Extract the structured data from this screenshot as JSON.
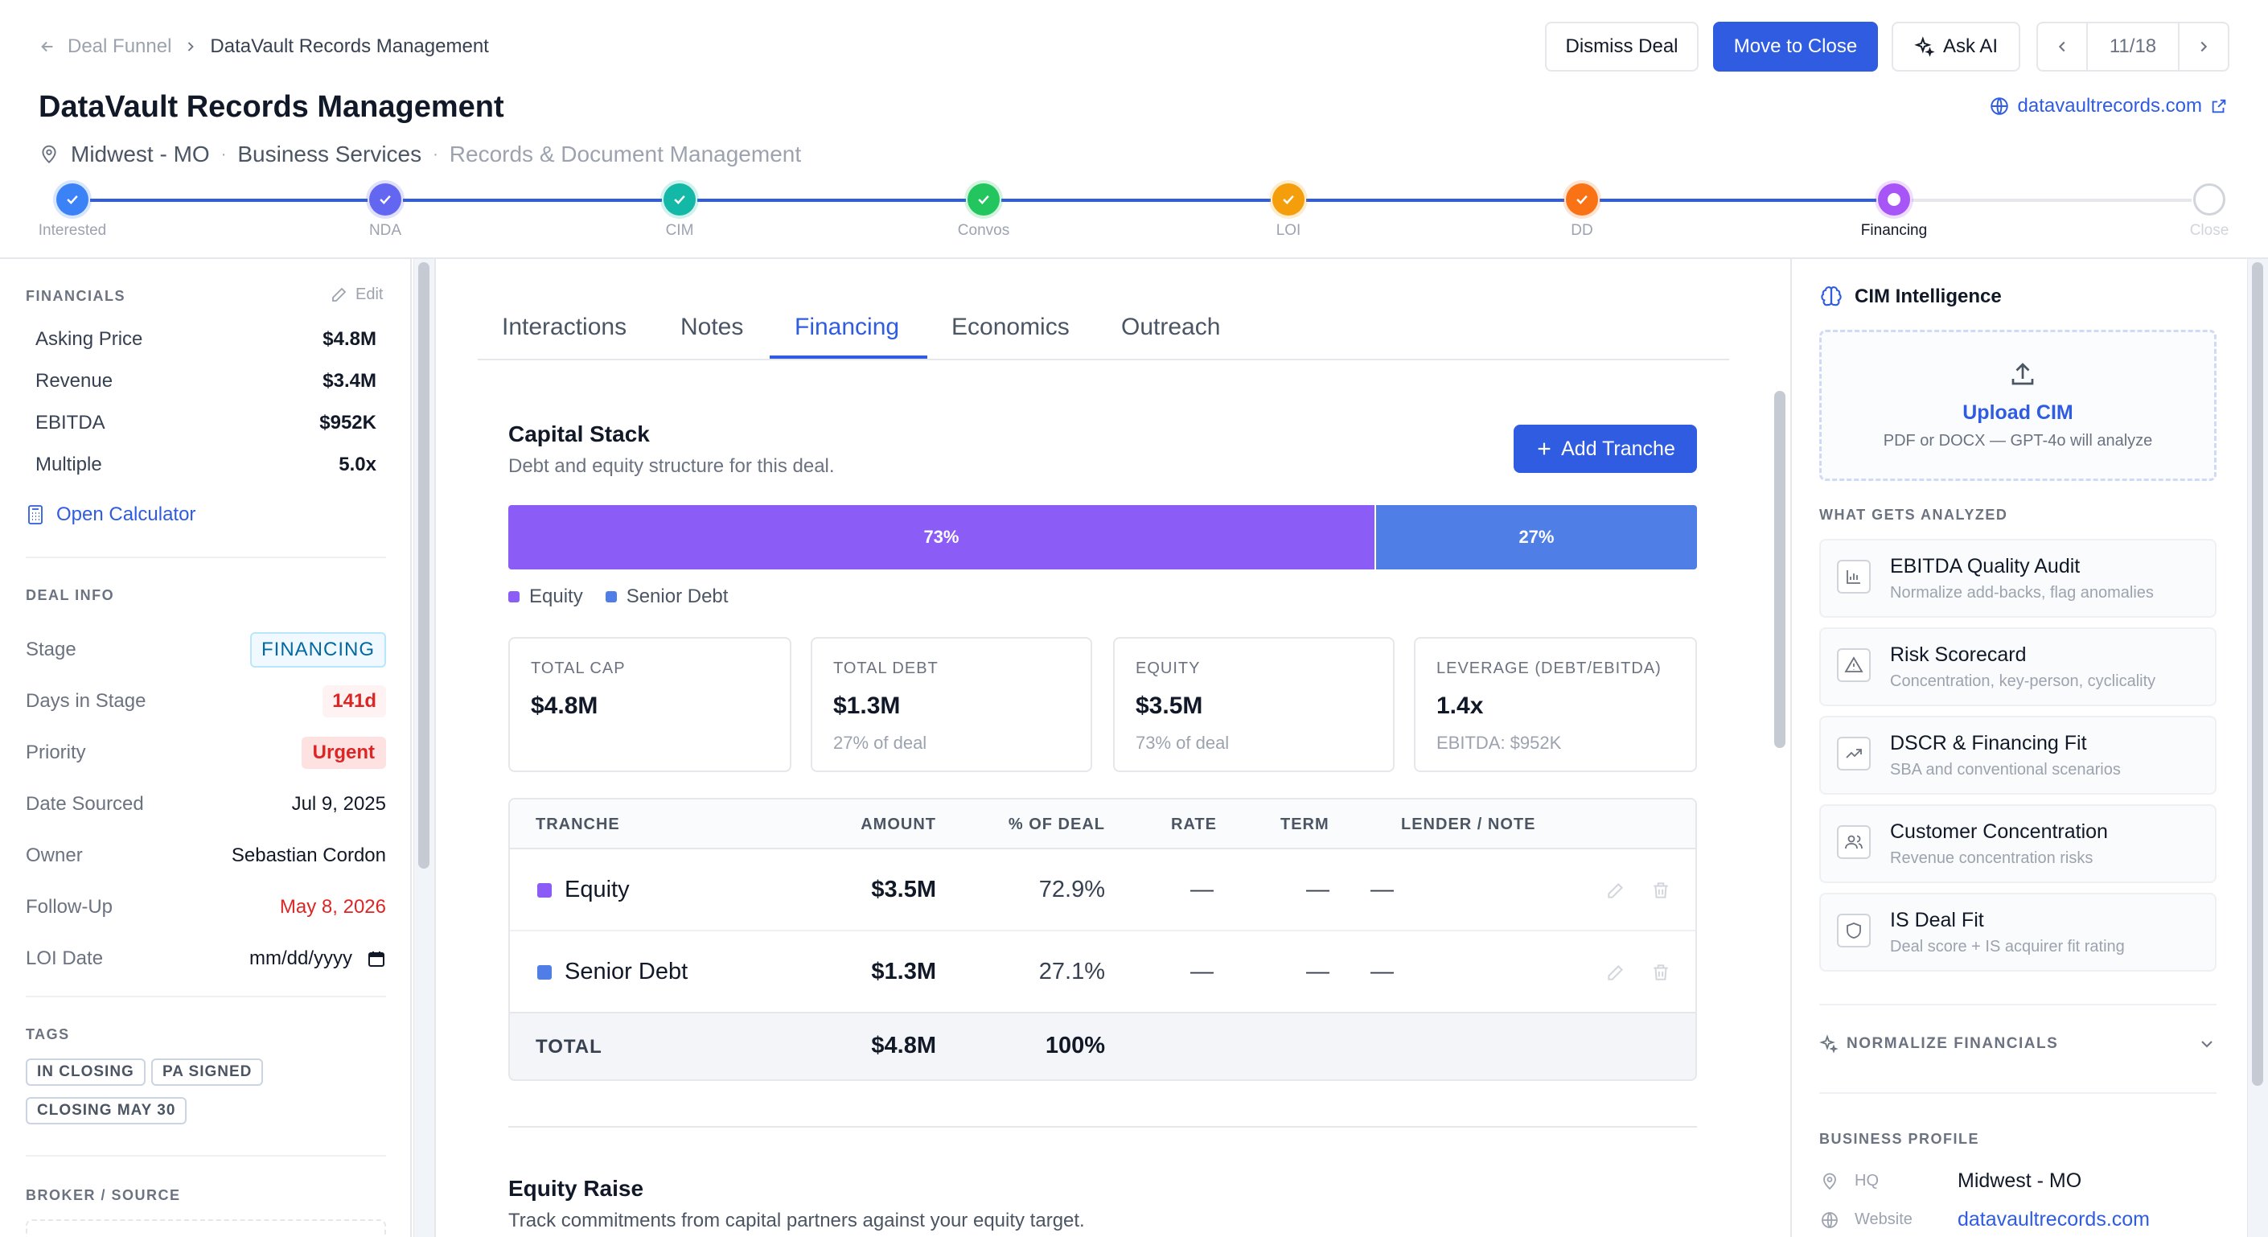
{
  "breadcrumb": {
    "parent": "Deal Funnel",
    "current": "DataVault Records Management"
  },
  "actions": {
    "dismiss": "Dismiss Deal",
    "move": "Move to Close",
    "ask_ai": "Ask AI",
    "pager": "11/18"
  },
  "company": {
    "name": "DataVault Records Management",
    "location": "Midwest - MO",
    "sector": "Business Services",
    "subsector": "Records & Document Management",
    "website": "datavaultrecords.com"
  },
  "stages": [
    {
      "label": "Interested",
      "state": "done",
      "color": "#3b82f6"
    },
    {
      "label": "NDA",
      "state": "done",
      "color": "#6366f1"
    },
    {
      "label": "CIM",
      "state": "done",
      "color": "#14b8a6"
    },
    {
      "label": "Convos",
      "state": "done",
      "color": "#22c55e"
    },
    {
      "label": "LOI",
      "state": "done",
      "color": "#f59e0b"
    },
    {
      "label": "DD",
      "state": "done",
      "color": "#f97316"
    },
    {
      "label": "Financing",
      "state": "current",
      "color": "#a855f7"
    },
    {
      "label": "Close",
      "state": "todo",
      "color": "#d1d5db"
    }
  ],
  "financials": {
    "section": "FINANCIALS",
    "edit": "Edit",
    "rows": [
      {
        "k": "Asking Price",
        "v": "$4.8M"
      },
      {
        "k": "Revenue",
        "v": "$3.4M"
      },
      {
        "k": "EBITDA",
        "v": "$952K"
      },
      {
        "k": "Multiple",
        "v": "5.0x"
      }
    ],
    "calculator": "Open Calculator"
  },
  "deal_info": {
    "section": "DEAL INFO",
    "stage_label": "Stage",
    "stage": "FINANCING",
    "days_label": "Days in Stage",
    "days": "141d",
    "priority_label": "Priority",
    "priority": "Urgent",
    "sourced_label": "Date Sourced",
    "sourced": "Jul 9, 2025",
    "owner_label": "Owner",
    "owner": "Sebastian Cordon",
    "follow_label": "Follow-Up",
    "follow": "May 8, 2026",
    "loi_label": "LOI Date",
    "loi_placeholder": "mm/dd/yyyy"
  },
  "tags": {
    "section": "TAGS",
    "items": [
      "IN CLOSING",
      "PA SIGNED",
      "CLOSING MAY 30"
    ]
  },
  "broker": {
    "section": "BROKER / SOURCE"
  },
  "tabs": [
    "Interactions",
    "Notes",
    "Financing",
    "Economics",
    "Outreach"
  ],
  "capital_stack": {
    "title": "Capital Stack",
    "subtitle": "Debt and equity structure for this deal.",
    "add": "Add Tranche",
    "equity_pct": 73,
    "debt_pct": 27,
    "equity_label": "73%",
    "debt_label": "27%",
    "legend": [
      "Equity",
      "Senior Debt"
    ],
    "colors": {
      "equity": "#8b5cf6",
      "debt": "#4f7fe6"
    }
  },
  "stats": [
    {
      "h": "TOTAL CAP",
      "v": "$4.8M",
      "s": ""
    },
    {
      "h": "TOTAL DEBT",
      "v": "$1.3M",
      "s": "27% of deal"
    },
    {
      "h": "EQUITY",
      "v": "$3.5M",
      "s": "73% of deal"
    },
    {
      "h": "LEVERAGE (DEBT/EBITDA)",
      "v": "1.4x",
      "s": "EBITDA: $952K"
    }
  ],
  "table": {
    "headers": [
      "TRANCHE",
      "AMOUNT",
      "% OF DEAL",
      "RATE",
      "TERM",
      "LENDER / NOTE"
    ],
    "rows": [
      {
        "name": "Equity",
        "amount": "$3.5M",
        "pct": "72.9%",
        "rate": "—",
        "term": "—",
        "lender": "—"
      },
      {
        "name": "Senior Debt",
        "amount": "$1.3M",
        "pct": "27.1%",
        "rate": "—",
        "term": "—",
        "lender": "—"
      }
    ],
    "total": {
      "name": "TOTAL",
      "amount": "$4.8M",
      "pct": "100%"
    }
  },
  "equity_raise": {
    "title": "Equity Raise",
    "subtitle": "Track commitments from capital partners against your equity target."
  },
  "cim": {
    "title": "CIM Intelligence",
    "upload": "Upload CIM",
    "upload_hint": "PDF or DOCX — GPT-4o will analyze",
    "analyzed_section": "WHAT GETS ANALYZED",
    "features": [
      {
        "t": "EBITDA Quality Audit",
        "d": "Normalize add-backs, flag anomalies",
        "icon": "bar-chart-icon"
      },
      {
        "t": "Risk Scorecard",
        "d": "Concentration, key-person, cyclicality",
        "icon": "warning-icon"
      },
      {
        "t": "DSCR & Financing Fit",
        "d": "SBA and conventional scenarios",
        "icon": "trend-up-icon"
      },
      {
        "t": "Customer Concentration",
        "d": "Revenue concentration risks",
        "icon": "users-icon"
      },
      {
        "t": "IS Deal Fit",
        "d": "Deal score + IS acquirer fit rating",
        "icon": "shield-icon"
      }
    ],
    "normalize": "NORMALIZE FINANCIALS",
    "profile_section": "BUSINESS PROFILE",
    "hq_label": "HQ",
    "hq": "Midwest - MO",
    "web_label": "Website",
    "web": "datavaultrecords.com"
  }
}
